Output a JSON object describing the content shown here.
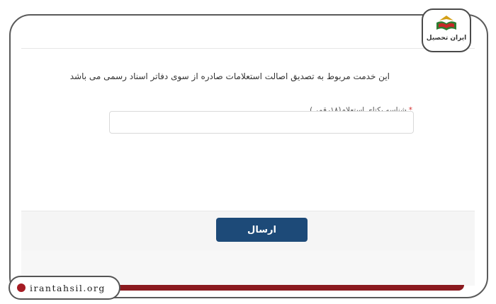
{
  "form": {
    "notice": "این خدمت مربوط به تصدیق اصالت استعلامات صادره از سوی دفاتر اسناد رسمی می باشد",
    "field_label": "شناسه یکتای استعلام(۱۸رقمی)",
    "required_mark": "*",
    "field_value": "",
    "submit_label": "ارسال"
  },
  "branding": {
    "logo_text": "ایران تحصیل",
    "site_url": "irantahsil.org"
  },
  "colors": {
    "button": "#1d4a78",
    "accent_red": "#8b1a1f",
    "required": "#d32f2f"
  },
  "icons": [
    "logo-icon",
    "globe-icon"
  ]
}
